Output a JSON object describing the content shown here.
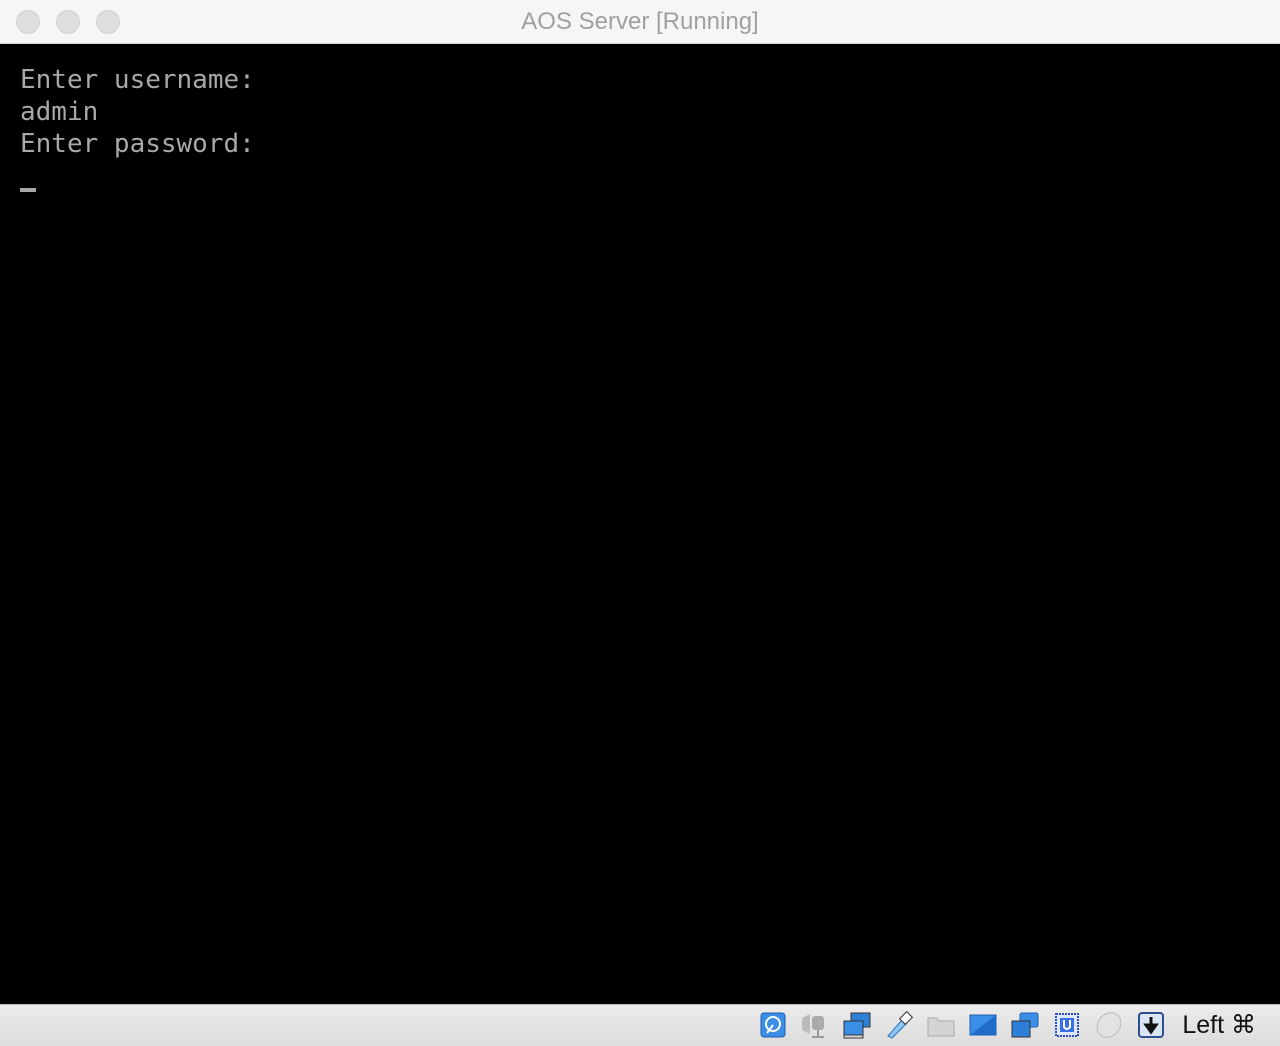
{
  "window": {
    "title": "AOS Server [Running]"
  },
  "terminal": {
    "lines": [
      "Enter username:",
      "admin",
      "Enter password:"
    ]
  },
  "statusbar": {
    "icons": [
      "hard-disk-icon",
      "audio-icon",
      "network-icon",
      "usb-icon",
      "shared-folders-icon",
      "display-icon",
      "video-capture-icon",
      "cpu-icon",
      "mouse-integration-icon",
      "keyboard-capture-icon"
    ],
    "host_key": "Left ⌘"
  }
}
